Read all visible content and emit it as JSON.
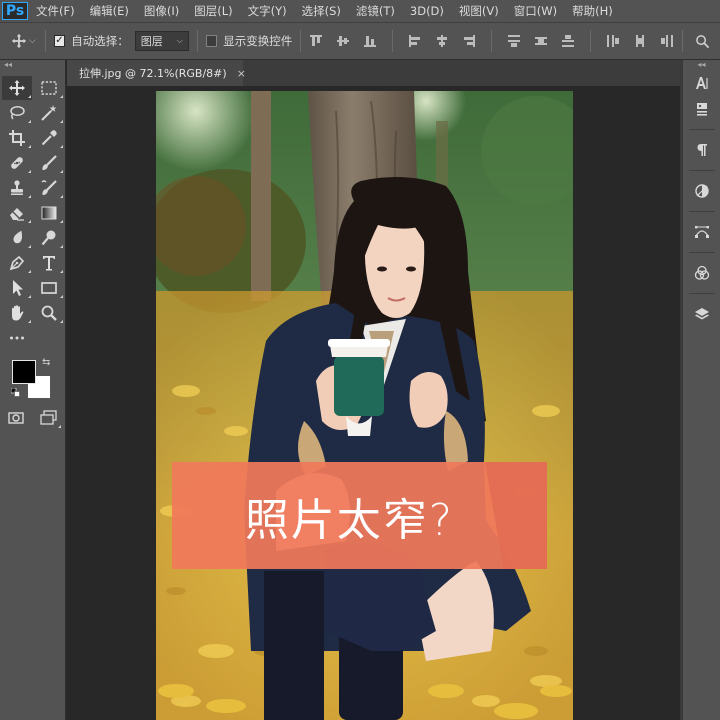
{
  "app": {
    "logo": "Ps"
  },
  "menu": [
    "文件(F)",
    "编辑(E)",
    "图像(I)",
    "图层(L)",
    "文字(Y)",
    "选择(S)",
    "滤镜(T)",
    "3D(D)",
    "视图(V)",
    "窗口(W)",
    "帮助(H)"
  ],
  "options": {
    "auto_select_label": "自动选择：",
    "auto_select_checked": true,
    "auto_select_target": "图层",
    "show_transform_label": "显示变换控件",
    "show_transform_checked": false
  },
  "document": {
    "tab_title": "拉伸.jpg @ 72.1%(RGB/8#)",
    "close_glyph": "×"
  },
  "overlay": {
    "text": "照片太窄?"
  },
  "tools": [
    "move-tool",
    "marquee-tool",
    "lasso-tool",
    "magic-wand-tool",
    "crop-tool",
    "eyedropper-tool",
    "healing-brush-tool",
    "brush-tool",
    "clone-stamp-tool",
    "history-brush-tool",
    "eraser-tool",
    "gradient-tool",
    "blur-tool",
    "dodge-tool",
    "pen-tool",
    "type-tool",
    "path-selection-tool",
    "rectangle-tool",
    "hand-tool",
    "zoom-tool"
  ],
  "colors": {
    "foreground": "#000000",
    "background": "#ffffff",
    "overlay": "#f0785a",
    "ps_blue": "#31a8ff"
  },
  "right_panels": [
    "character-panel",
    "libraries-panel",
    "paragraph-panel",
    "adjustments-panel",
    "paths-panel",
    "channels-panel",
    "layers-panel"
  ]
}
